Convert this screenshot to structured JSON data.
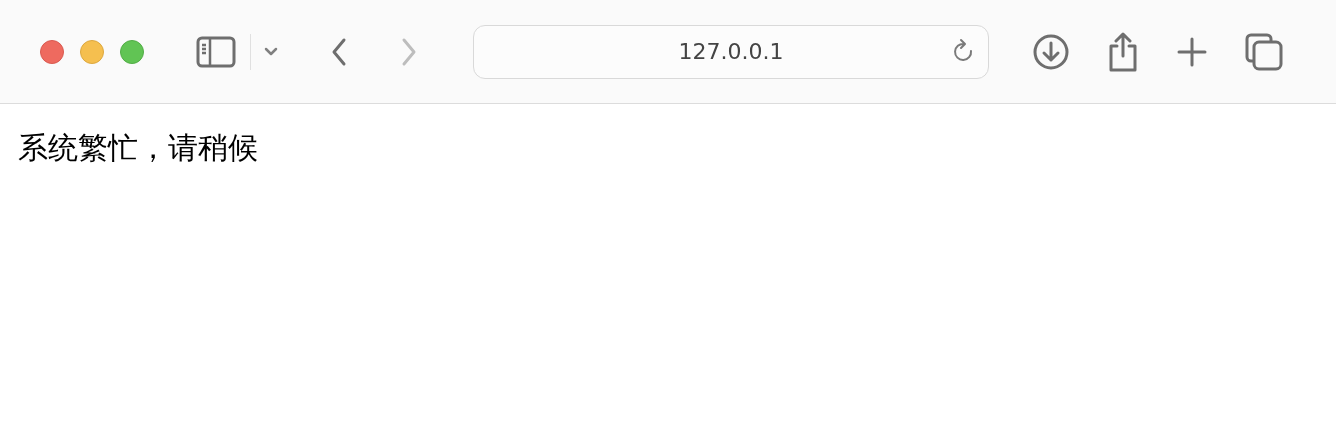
{
  "toolbar": {
    "nav": [
      {
        "kind": "back",
        "disabled": false
      },
      {
        "kind": "forward",
        "disabled": true
      }
    ],
    "address": "127.0.0.1"
  },
  "page": {
    "text": "系统繁忙，请稍候"
  }
}
